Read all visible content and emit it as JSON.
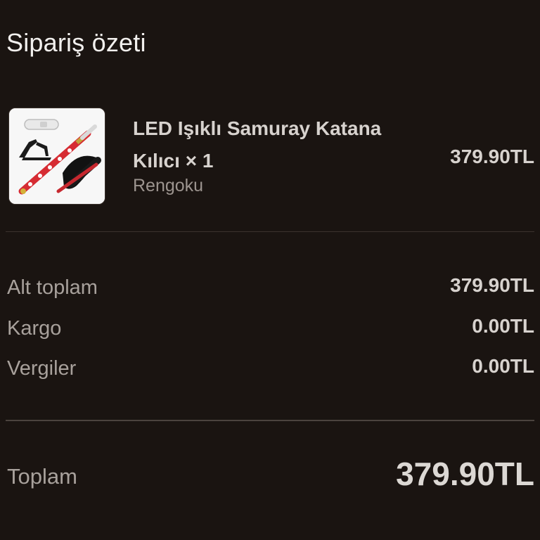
{
  "summary": {
    "title": "Sipariş özeti"
  },
  "item": {
    "image_alt": "katana-product-image",
    "name": "LED Işıklı Samuray Katana Kılıcı × 1",
    "variant": "Rengoku",
    "price": "379.90TL"
  },
  "costs": {
    "subtotal_label": "Alt toplam",
    "subtotal_value": "379.90TL",
    "shipping_label": "Kargo",
    "shipping_value": "0.00TL",
    "taxes_label": "Vergiler",
    "taxes_value": "0.00TL"
  },
  "total": {
    "label": "Toplam",
    "value": "379.90TL"
  },
  "colors": {
    "background": "#1a1411",
    "text_primary": "#d7d2ce",
    "text_secondary": "#a8a19c"
  }
}
